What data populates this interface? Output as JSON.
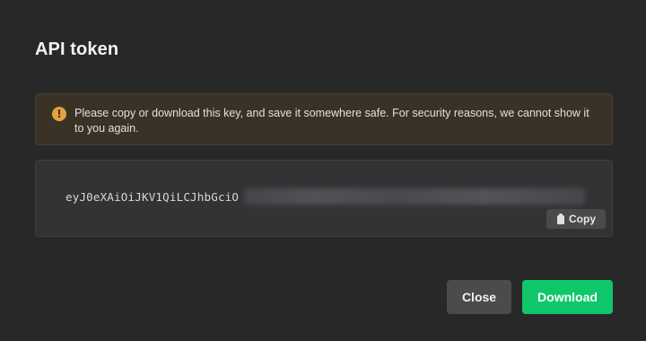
{
  "dialog": {
    "title": "API token",
    "warning": {
      "icon": "warning-icon",
      "icon_glyph": "!",
      "text": "Please copy or download this key, and save it somewhere safe. For security reasons, we cannot show it to you again.",
      "accent_color": "#e6a23c"
    },
    "token": {
      "visible_prefix": "eyJ0eXAiOiJKV1QiLCJhbGciO",
      "copy_label": "Copy",
      "copy_icon": "clipboard-icon"
    },
    "buttons": {
      "close_label": "Close",
      "download_label": "Download",
      "download_color": "#0fc76a"
    }
  }
}
